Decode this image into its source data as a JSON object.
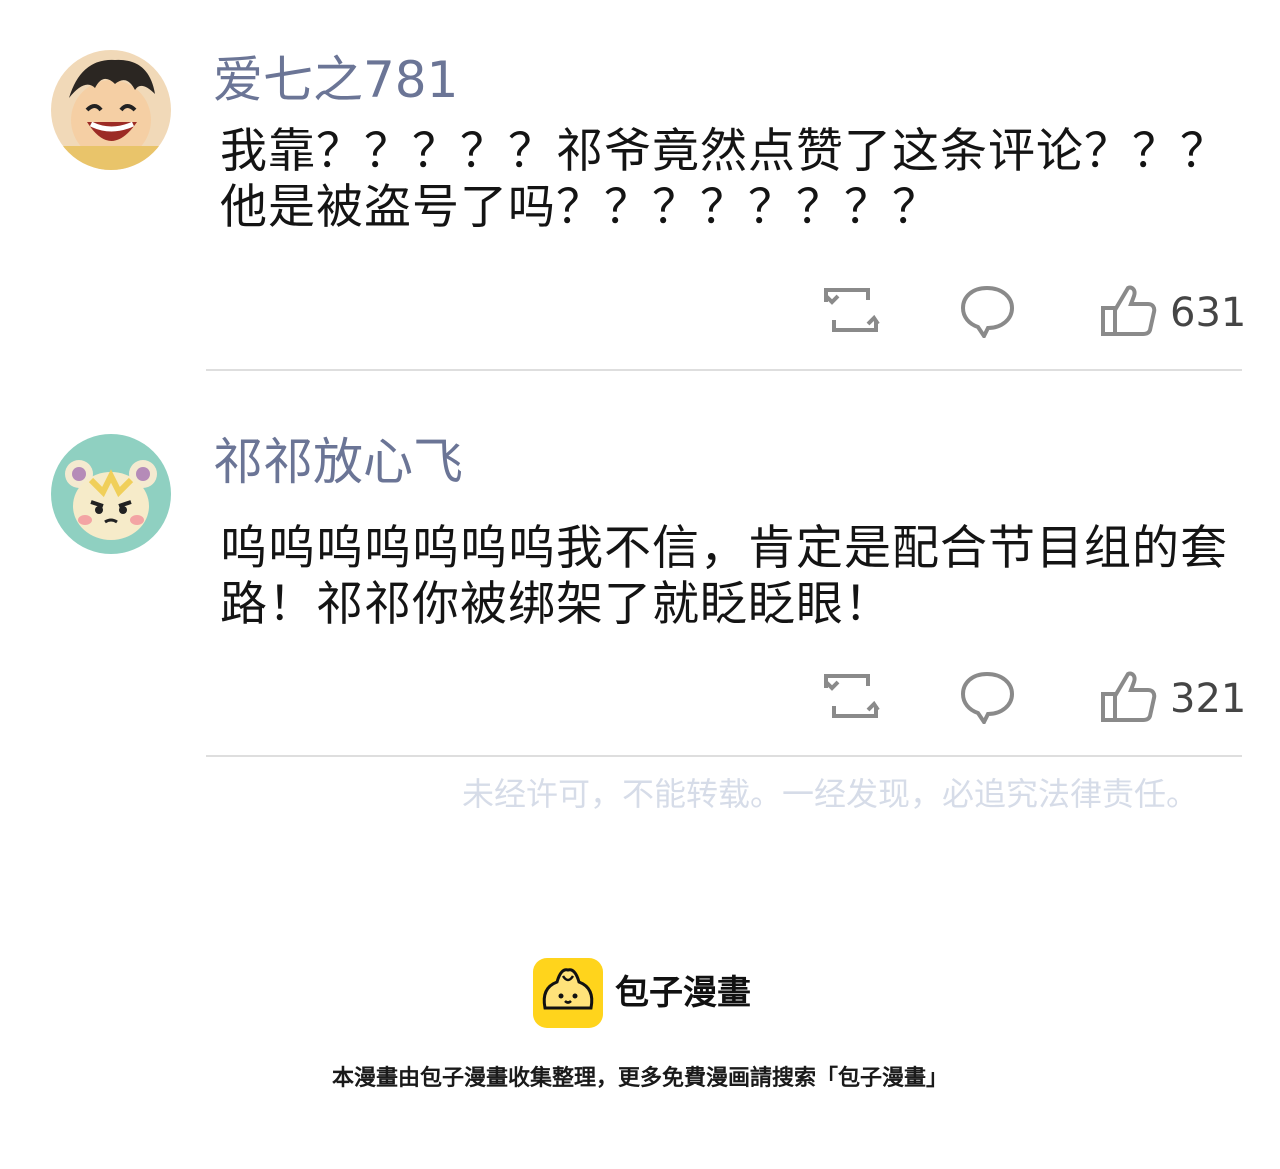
{
  "comments": [
    {
      "username": "爱七之781",
      "text": "我靠？？？？？祁爷竟然点赞了这条评论？？？他是被盗号了吗？？？？？？？？",
      "likes": "631",
      "avatar_icon": "anime-boy-laughing-avatar"
    },
    {
      "username": "祁祁放心飞",
      "text": "呜呜呜呜呜呜呜我不信，肯定是配合节目组的套路！祁祁你被绑架了就眨眨眼！",
      "likes": "321",
      "avatar_icon": "cartoon-hamster-avatar"
    }
  ],
  "action_icons": [
    "repost-icon",
    "comment-bubble-icon",
    "thumbs-up-icon"
  ],
  "watermark": "未经许可，不能转载。一经发现，必追究法律责任。",
  "brand": {
    "name": "包子漫畫",
    "logo_color": "#ffd41c"
  },
  "footer_note": "本漫畫由包子漫畫收集整理，更多免費漫画請搜索「包子漫畫」"
}
